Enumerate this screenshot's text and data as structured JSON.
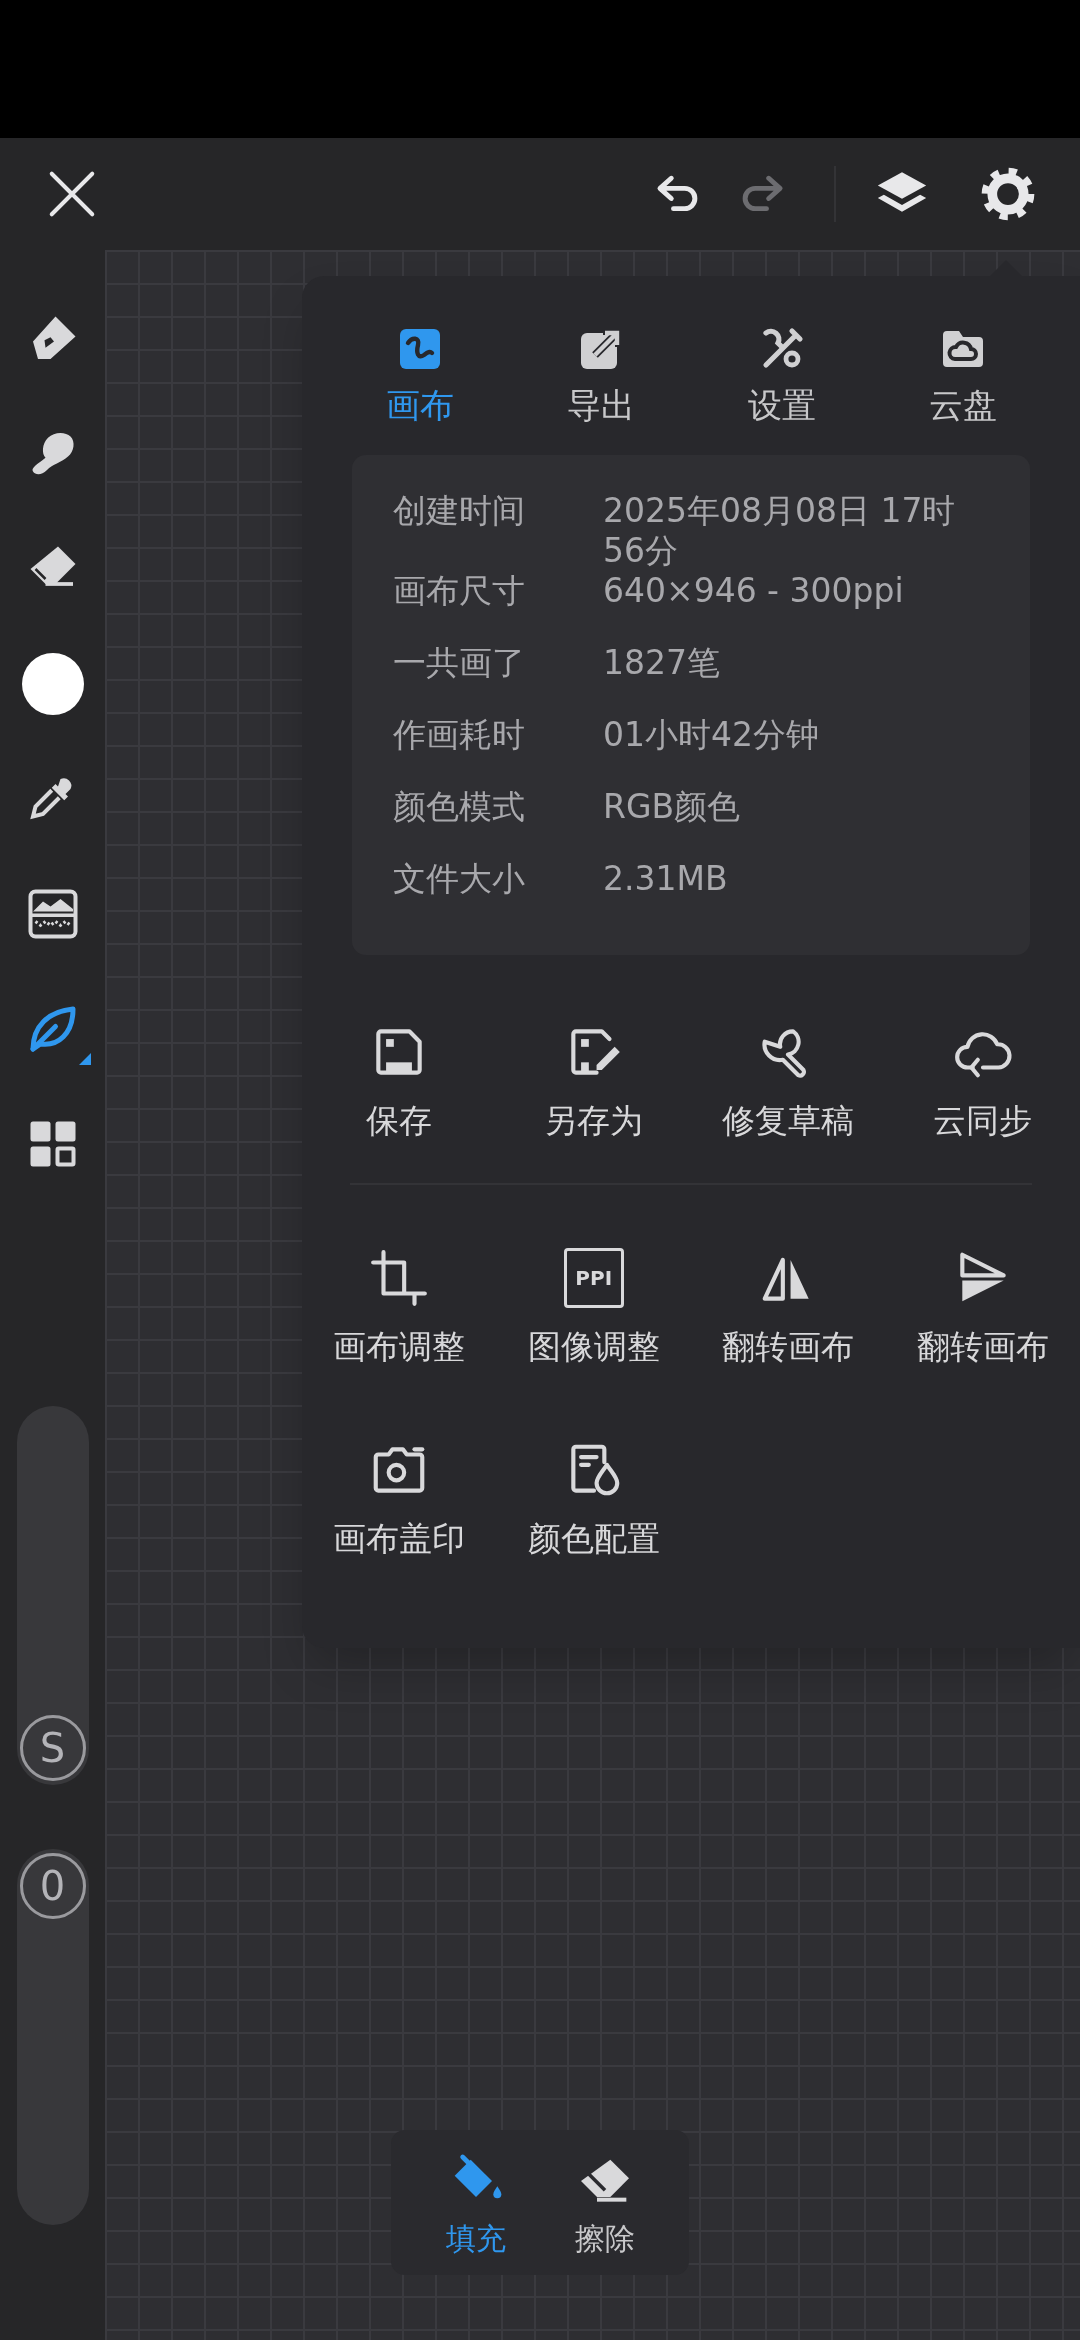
{
  "top_bar": {
    "buttons": [
      {
        "kind": "close",
        "disabled": false
      },
      {
        "kind": "undo",
        "disabled": false
      },
      {
        "kind": "redo",
        "disabled": true
      },
      {
        "kind": "layers",
        "disabled": false
      },
      {
        "kind": "settings",
        "disabled": false
      }
    ]
  },
  "tools": [
    {
      "kind": "pen",
      "selected": false
    },
    {
      "kind": "smudge",
      "selected": false
    },
    {
      "kind": "eraser",
      "selected": false
    },
    {
      "kind": "color",
      "selected": false,
      "color": "#ffffff"
    },
    {
      "kind": "eyedropper",
      "selected": false
    },
    {
      "kind": "adjust",
      "selected": false
    },
    {
      "kind": "leaf",
      "selected": true
    },
    {
      "kind": "grid",
      "selected": false
    }
  ],
  "sliders": [
    {
      "thumb": "S",
      "level": 0
    },
    {
      "thumb": "0",
      "level": 1
    }
  ],
  "panel": {
    "tabs": [
      {
        "kind": "canvas",
        "label": "画布",
        "selected": true
      },
      {
        "kind": "export",
        "label": "导出",
        "selected": false
      },
      {
        "kind": "settings",
        "label": "设置",
        "selected": false
      },
      {
        "kind": "cloud",
        "label": "云盘",
        "selected": false
      }
    ],
    "info": [
      {
        "label": "创建时间",
        "value": "2025年08月08日 17时56分"
      },
      {
        "label": "画布尺寸",
        "value": "640×946 - 300ppi"
      },
      {
        "label": "一共画了",
        "value": "1827笔"
      },
      {
        "label": "作画耗时",
        "value": "01小时42分钟"
      },
      {
        "label": "颜色模式",
        "value": "RGB颜色"
      },
      {
        "label": "文件大小",
        "value": "2.31MB"
      }
    ],
    "file_actions": [
      {
        "kind": "save",
        "label": "保存"
      },
      {
        "kind": "save_as",
        "label": "另存为"
      },
      {
        "kind": "repair",
        "label": "修复草稿"
      },
      {
        "kind": "cloud_sync",
        "label": "云同步"
      }
    ],
    "canvas_actions": [
      {
        "kind": "crop",
        "label": "画布调整"
      },
      {
        "kind": "ppi",
        "label": "图像调整",
        "badge": "PPI"
      },
      {
        "kind": "flip_h",
        "label": "翻转画布"
      },
      {
        "kind": "flip_v",
        "label": "翻转画布"
      },
      {
        "kind": "stamp",
        "label": "画布盖印"
      },
      {
        "kind": "color_profile",
        "label": "颜色配置"
      }
    ]
  },
  "fill_toolbar": [
    {
      "kind": "fill",
      "label": "填充",
      "selected": true
    },
    {
      "kind": "erase",
      "label": "擦除",
      "selected": false
    }
  ]
}
